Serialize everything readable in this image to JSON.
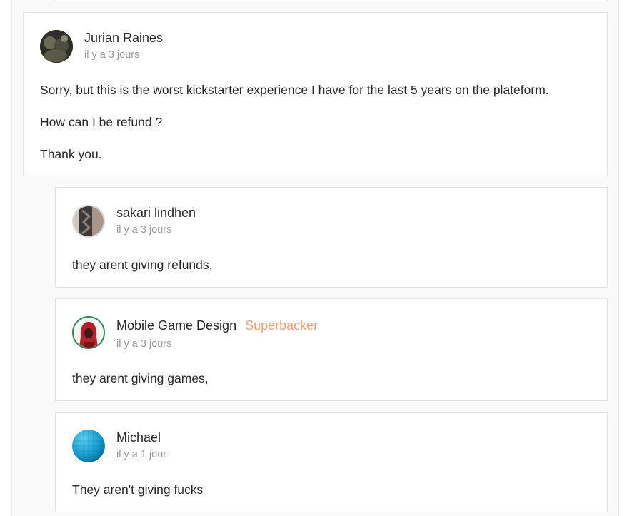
{
  "comments": [
    {
      "author": "Jurian Raines",
      "time": "il y a 3 jours",
      "avatar_icon": "user-photo-dark-avatar",
      "paragraphs": [
        "Sorry, but this is the worst kickstarter experience I have for the last 5 years on the plateform.",
        "How can I be refund ?",
        "Thank you."
      ]
    }
  ],
  "replies": [
    {
      "author": "sakari lindhen",
      "time": "il y a 3 jours",
      "avatar_icon": "tattoo-photo-avatar",
      "text": "they arent giving refunds,"
    },
    {
      "author": "Mobile Game Design",
      "badge": "Superbacker",
      "badge_color": "#e9a37a",
      "time": "il y a 3 jours",
      "avatar_icon": "red-hood-avatar",
      "text": "they arent giving games,"
    },
    {
      "author": "Michael",
      "time": "il y a 1 jour",
      "avatar_icon": "blue-sphere-avatar",
      "text": "They aren't giving fucks"
    }
  ]
}
